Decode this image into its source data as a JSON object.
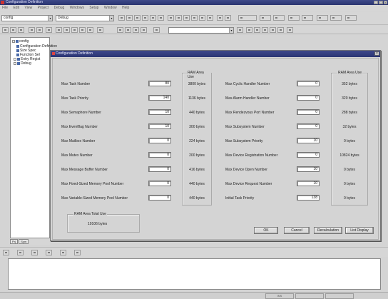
{
  "app": {
    "title": "Configuration Definition"
  },
  "menu": [
    "File",
    "Edit",
    "View",
    "Project",
    "Debug",
    "Windows",
    "Setup",
    "Window",
    "Help"
  ],
  "toolbar": {
    "combo1": "config",
    "combo2": "Debug"
  },
  "tree": {
    "root": "config",
    "items": [
      "Configuration Definition",
      "Size Spec",
      "Function Sel",
      "Entry Regist",
      "Debug"
    ]
  },
  "side_tabs": [
    "Prj",
    "Sym"
  ],
  "dialog": {
    "title": "Configuration Definition",
    "left_col_header": "RAM Area Use",
    "right_col_header": "RAM Area Use",
    "left_rows": [
      {
        "label": "Max Task Number",
        "value": "80",
        "size": "3800 bytes"
      },
      {
        "label": "Max Task Priority",
        "value": "140",
        "size": "1136 bytes"
      },
      {
        "label": "Max Semaphore Number",
        "value": "10",
        "size": "440 bytes"
      },
      {
        "label": "Max Eventflag Number",
        "value": "10",
        "size": "300 bytes"
      },
      {
        "label": "Max Mailbox Number",
        "value": "0",
        "size": "224 bytes"
      },
      {
        "label": "Max Mutex Number",
        "value": "0",
        "size": "200 bytes"
      },
      {
        "label": "Max Message Buffer Number",
        "value": "0",
        "size": "416 bytes"
      },
      {
        "label": "Max Fixed-Sized Memory Pool Number",
        "value": "0",
        "size": "440 bytes"
      },
      {
        "label": "Max Variable-Sized Memory Pool Number",
        "value": "0",
        "size": "440 bytes"
      }
    ],
    "right_rows": [
      {
        "label": "Max Cyclic Handler Number",
        "value": "0",
        "size": "352 bytes"
      },
      {
        "label": "Max Alarm Handler Number",
        "value": "0",
        "size": "320 bytes"
      },
      {
        "label": "Max Rendezvous Port Number",
        "value": "0",
        "size": "288 bytes"
      },
      {
        "label": "Max Subsystem Number",
        "value": "0",
        "size": "32 bytes"
      },
      {
        "label": "Max Subsystem Priority",
        "value": "10",
        "size": "0 bytes"
      },
      {
        "label": "Max Device Registration Number",
        "value": "0",
        "size": "10824 bytes"
      },
      {
        "label": "Max Device Open Number",
        "value": "10",
        "size": "0 bytes"
      },
      {
        "label": "Max Device Request Number",
        "value": "10",
        "size": "0 bytes"
      },
      {
        "label": "Initial Task Priority",
        "value": "138",
        "size": "0 bytes"
      }
    ],
    "total_group_label": "RAM Area Total Use",
    "total_value": "19106 bytes",
    "buttons": {
      "ok": "OK",
      "cancel": "Cancel",
      "recalc": "Recalculation",
      "list": "List Display"
    }
  },
  "status": {
    "cell1": "INS",
    "cell2": ""
  }
}
